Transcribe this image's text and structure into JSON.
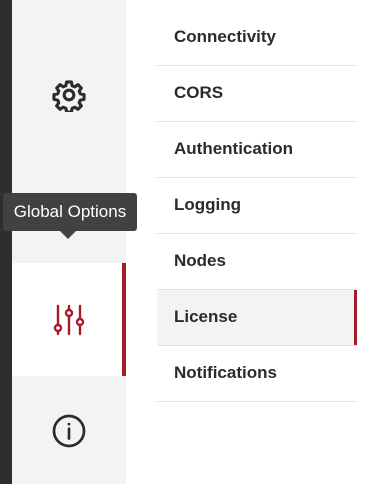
{
  "tooltip": {
    "text": "Global Options"
  },
  "rail": {
    "items": [
      {
        "icon": "gear-icon",
        "active": false
      },
      {
        "icon": "user-icon",
        "active": false
      },
      {
        "icon": "sliders-icon",
        "active": true
      },
      {
        "icon": "info-icon",
        "active": false
      }
    ]
  },
  "menu": {
    "items": [
      {
        "label": "Connectivity"
      },
      {
        "label": "CORS"
      },
      {
        "label": "Authentication"
      },
      {
        "label": "Logging"
      },
      {
        "label": "Nodes"
      },
      {
        "label": "License",
        "selected": true
      },
      {
        "label": "Notifications"
      }
    ]
  },
  "colors": {
    "accent": "#a11d2a",
    "rail_background": "#f3f3f3",
    "dark_edge": "#2e2e2e",
    "tooltip_background": "#414141",
    "text": "#2b2b2b",
    "divider": "#e1e1e1"
  }
}
